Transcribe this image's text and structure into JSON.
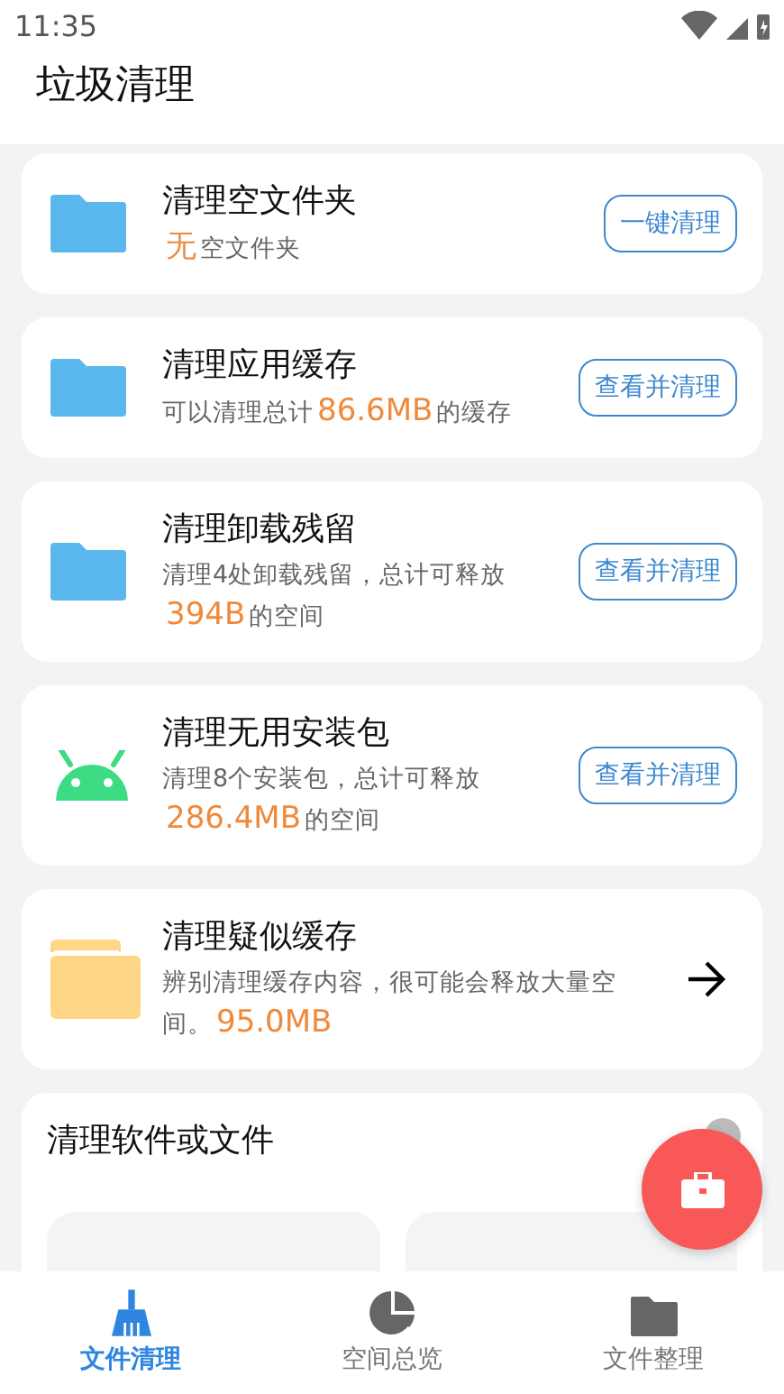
{
  "status_bar": {
    "time": "11:35"
  },
  "header": {
    "title": "垃圾清理"
  },
  "cards": [
    {
      "kind": "folder",
      "title": "清理空文件夹",
      "desc": [
        {
          "kind": "amount",
          "text": "无"
        },
        {
          "kind": "text",
          "text": "空文件夹"
        }
      ],
      "action": {
        "kind": "button",
        "label": "一键清理"
      }
    },
    {
      "kind": "folder",
      "title": "清理应用缓存",
      "desc": [
        {
          "kind": "text",
          "text": "可以清理总计"
        },
        {
          "kind": "amount",
          "text": "86.6MB"
        },
        {
          "kind": "text",
          "text": "的缓存"
        }
      ],
      "action": {
        "kind": "button",
        "label": "查看并清理"
      }
    },
    {
      "kind": "folder",
      "title": "清理卸载残留",
      "desc": [
        {
          "kind": "text",
          "text": "清理4处卸载残留，总计可释放"
        },
        {
          "kind": "amount",
          "text": "394B"
        },
        {
          "kind": "text",
          "text": "的空间"
        }
      ],
      "action": {
        "kind": "button",
        "label": "查看并清理"
      }
    },
    {
      "kind": "package",
      "title": "清理无用安装包",
      "desc": [
        {
          "kind": "text",
          "text": "清理8个安装包，总计可释放"
        },
        {
          "kind": "amount",
          "text": "286.4MB"
        },
        {
          "kind": "text",
          "text": "的空间"
        }
      ],
      "action": {
        "kind": "button",
        "label": "查看并清理"
      }
    },
    {
      "kind": "suspect",
      "title": "清理疑似缓存",
      "desc": [
        {
          "kind": "text",
          "text": "辨别清理缓存内容，很可能会释放大量空"
        },
        {
          "kind": "text",
          "text": "间。"
        },
        {
          "kind": "amount",
          "text": "95.0MB"
        }
      ],
      "action": {
        "kind": "arrow"
      }
    }
  ],
  "section": {
    "title": "清理软件或文件"
  },
  "nav": [
    {
      "label": "文件清理",
      "selected": true
    },
    {
      "label": "空间总览",
      "selected": false
    },
    {
      "label": "文件整理",
      "selected": false
    }
  ]
}
